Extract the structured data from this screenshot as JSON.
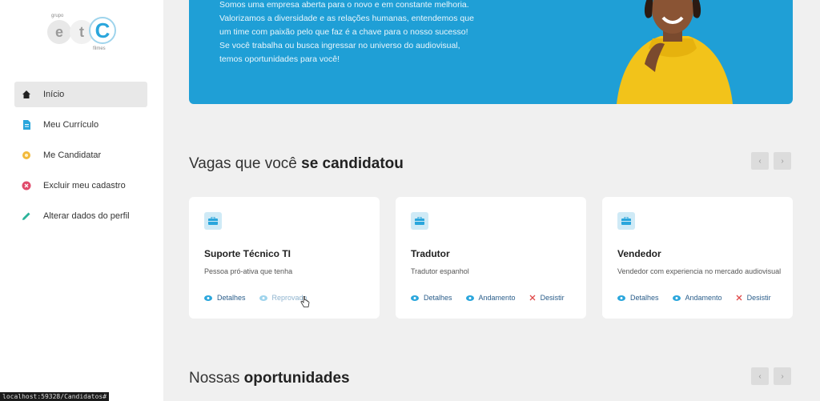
{
  "logo": {
    "top": "grupo",
    "letters": [
      "e",
      "t",
      "C"
    ],
    "bottom": "filmes"
  },
  "sidebar": {
    "items": [
      {
        "label": "Início",
        "icon": "home-icon",
        "active": true
      },
      {
        "label": "Meu Currículo",
        "icon": "document-icon",
        "active": false
      },
      {
        "label": "Me Candidatar",
        "icon": "star-badge-icon",
        "active": false
      },
      {
        "label": "Excluir meu cadastro",
        "icon": "remove-circle-icon",
        "active": false
      },
      {
        "label": "Alterar dados do perfil",
        "icon": "pencil-icon",
        "active": false
      }
    ]
  },
  "banner": {
    "lines": [
      "Somos uma empresa aberta para o novo e em constante melhoria.",
      "Valorizamos a diversidade e as relações humanas, entendemos que",
      "um time com paixão pelo que faz é a chave para o nosso sucesso!",
      "Se você trabalha ou busca ingressar no universo do audiovisual,",
      "temos oportunidades para você!"
    ]
  },
  "applied": {
    "title_regular": "Vagas que você ",
    "title_bold": "se candidatou",
    "cards": [
      {
        "title": "Suporte Técnico TI",
        "desc": "Pessoa pró-ativa que tenha",
        "actions": [
          "Detalhes",
          "Reprovado"
        ]
      },
      {
        "title": "Tradutor",
        "desc": "Tradutor espanhol",
        "actions": [
          "Detalhes",
          "Andamento",
          "Desistir"
        ]
      },
      {
        "title": "Vendedor",
        "desc": "Vendedor com experiencia no mercado audiovisual",
        "actions": [
          "Detalhes",
          "Andamento",
          "Desistir"
        ]
      }
    ]
  },
  "opportunities": {
    "title_regular": "Nossas ",
    "title_bold": "oportunidades"
  },
  "statusbar": "localhost:59328/Candidatos#",
  "colors": {
    "accent": "#1f9fd6",
    "link": "#2a5d8a",
    "danger": "#e04a4a"
  }
}
